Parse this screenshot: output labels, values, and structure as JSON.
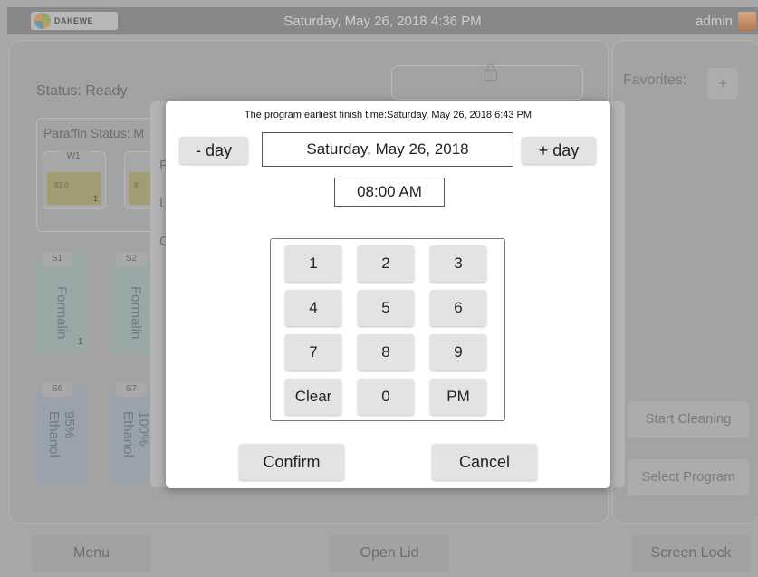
{
  "topbar": {
    "logo_text": "DAKEWE",
    "datetime": "Saturday, May 26, 2018  4:36 PM",
    "user": "admin"
  },
  "background": {
    "status": "Status:  Ready",
    "paraffin_status": "Paraffin Status: M",
    "w1_label": "W1",
    "w1_value": "63.0",
    "w1_count": "1",
    "partial_value": "6",
    "partial_letters": [
      "P",
      "L",
      "C"
    ],
    "station_s1": "S1",
    "station_s2": "S2",
    "station_s6": "S6",
    "station_s7": "S7",
    "formalin": "Formalin",
    "s1_count": "1",
    "ethanol_95": "95% Ethanol",
    "ethanol_100": "100% Ethanol",
    "favorites": "Favorites:",
    "favorites_add": "+",
    "start_cleaning": "Start Cleaning",
    "select_program": "Select Program"
  },
  "footer": {
    "menu": "Menu",
    "open_lid": "Open Lid",
    "screen_lock": "Screen Lock"
  },
  "dialog": {
    "earliest_finish": "The program earliest finish time:Saturday, May 26, 2018  6:43 PM",
    "minus_day": "- day",
    "plus_day": "+ day",
    "date": "Saturday, May 26, 2018",
    "time": "08:00  AM",
    "keys": [
      "1",
      "2",
      "3",
      "4",
      "5",
      "6",
      "7",
      "8",
      "9",
      "Clear",
      "0",
      "PM"
    ],
    "confirm": "Confirm",
    "cancel": "Cancel"
  }
}
